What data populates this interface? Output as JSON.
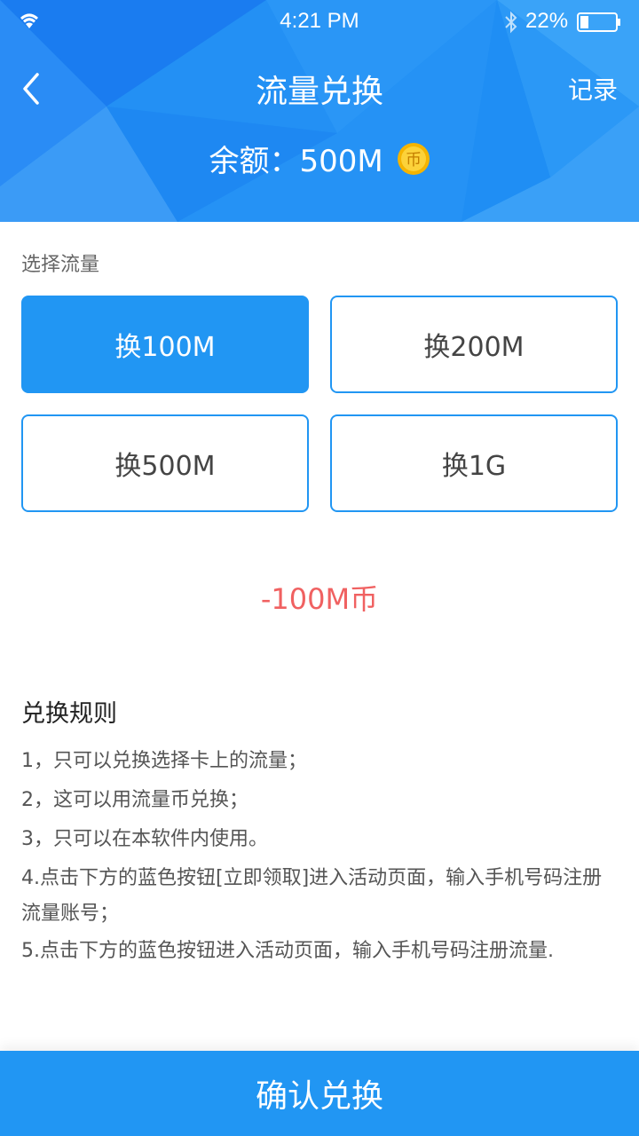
{
  "status_bar": {
    "time": "4:21 PM",
    "battery": "22%",
    "icons": [
      "wifi-icon",
      "bluetooth-icon",
      "battery-icon"
    ]
  },
  "header": {
    "title": "流量兑换",
    "record_label": "记录",
    "balance_label": "余额：500M",
    "coin_glyph": "币",
    "back_icon": "chevron-left-icon"
  },
  "select": {
    "label": "选择流量",
    "options": [
      {
        "label": "换100M",
        "selected": true
      },
      {
        "label": "换200M",
        "selected": false
      },
      {
        "label": "换500M",
        "selected": false
      },
      {
        "label": "换1G",
        "selected": false
      }
    ]
  },
  "cost_text": "-100M币",
  "rules": {
    "title": "兑换规则",
    "items": [
      "1，只可以兑换选择卡上的流量；",
      "2，这可以用流量币兑换；",
      "3，只可以在本软件内使用。",
      "4.点击下方的蓝色按钮[立即领取]进入活动页面，输入手机号码注册流量账号；",
      "5.点击下方的蓝色按钮进入活动页面，输入手机号码注册流量."
    ]
  },
  "confirm_label": "确认兑换",
  "colors": {
    "primary": "#2196f3",
    "accent_red": "#f06161",
    "coin": "#f5b400"
  }
}
